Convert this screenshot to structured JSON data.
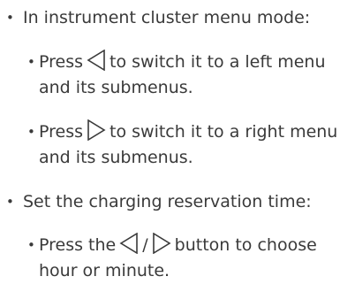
{
  "items": [
    {
      "text": "In instrument cluster menu mode:",
      "sub": [
        {
          "before": "Press",
          "icons": [
            "left-triangle-icon"
          ],
          "after": "to switch it to a left menu",
          "line2": "and its submenus."
        },
        {
          "before": "Press",
          "icons": [
            "right-triangle-icon"
          ],
          "after": "to switch it to a right menu",
          "line2": "and its submenus."
        }
      ]
    },
    {
      "text": "Set the charging reservation time:",
      "sub": [
        {
          "before": "Press the",
          "separator": "/",
          "icons": [
            "left-triangle-icon",
            "right-triangle-icon"
          ],
          "after": "button to choose",
          "line2": "hour or minute."
        }
      ]
    }
  ],
  "bullet_glyph": "•"
}
